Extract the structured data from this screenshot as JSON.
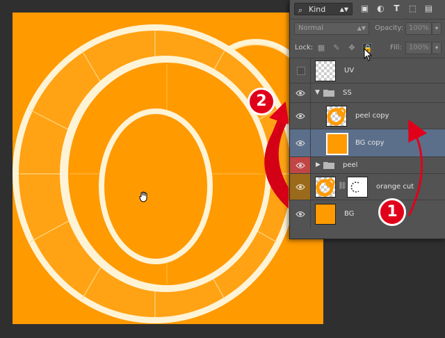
{
  "toolbar": {
    "filter_kind": "Kind",
    "filter_icons": [
      "image-filter-icon",
      "adjustment-filter-icon",
      "type-filter-icon",
      "shape-filter-icon",
      "smart-object-filter-icon"
    ]
  },
  "blend": {
    "mode": "Normal",
    "opacity_label": "Opacity:",
    "opacity_value": "100%",
    "lock_label": "Lock:",
    "fill_label": "Fill:",
    "fill_value": "100%"
  },
  "layers": [
    {
      "name": "UV",
      "type": "layer",
      "visible": false,
      "thumb": "checker"
    },
    {
      "name": "SS",
      "type": "group",
      "expanded": true,
      "visible": true
    },
    {
      "name": "peel copy",
      "type": "layer",
      "visible": true,
      "thumb": "orange-ring",
      "indent": true
    },
    {
      "name": "BG copy",
      "type": "layer",
      "visible": true,
      "thumb": "orange",
      "indent": true,
      "selected": true
    },
    {
      "name": "peel",
      "type": "group",
      "expanded": false,
      "visible": true,
      "eye_highlight": "#c04545"
    },
    {
      "name": "orange cut",
      "type": "layer",
      "visible": true,
      "thumb": "orange-ring",
      "mask": true,
      "eye_highlight": "#9b6a1a"
    },
    {
      "name": "BG",
      "type": "layer",
      "visible": true,
      "thumb": "orange"
    }
  ],
  "annotations": {
    "badge_1": "1",
    "badge_2": "2",
    "color": "#e0001a"
  },
  "colors": {
    "canvas_orange": "#ff9a00",
    "panel_bg": "#535353",
    "selected_row": "#5b6f8a"
  }
}
